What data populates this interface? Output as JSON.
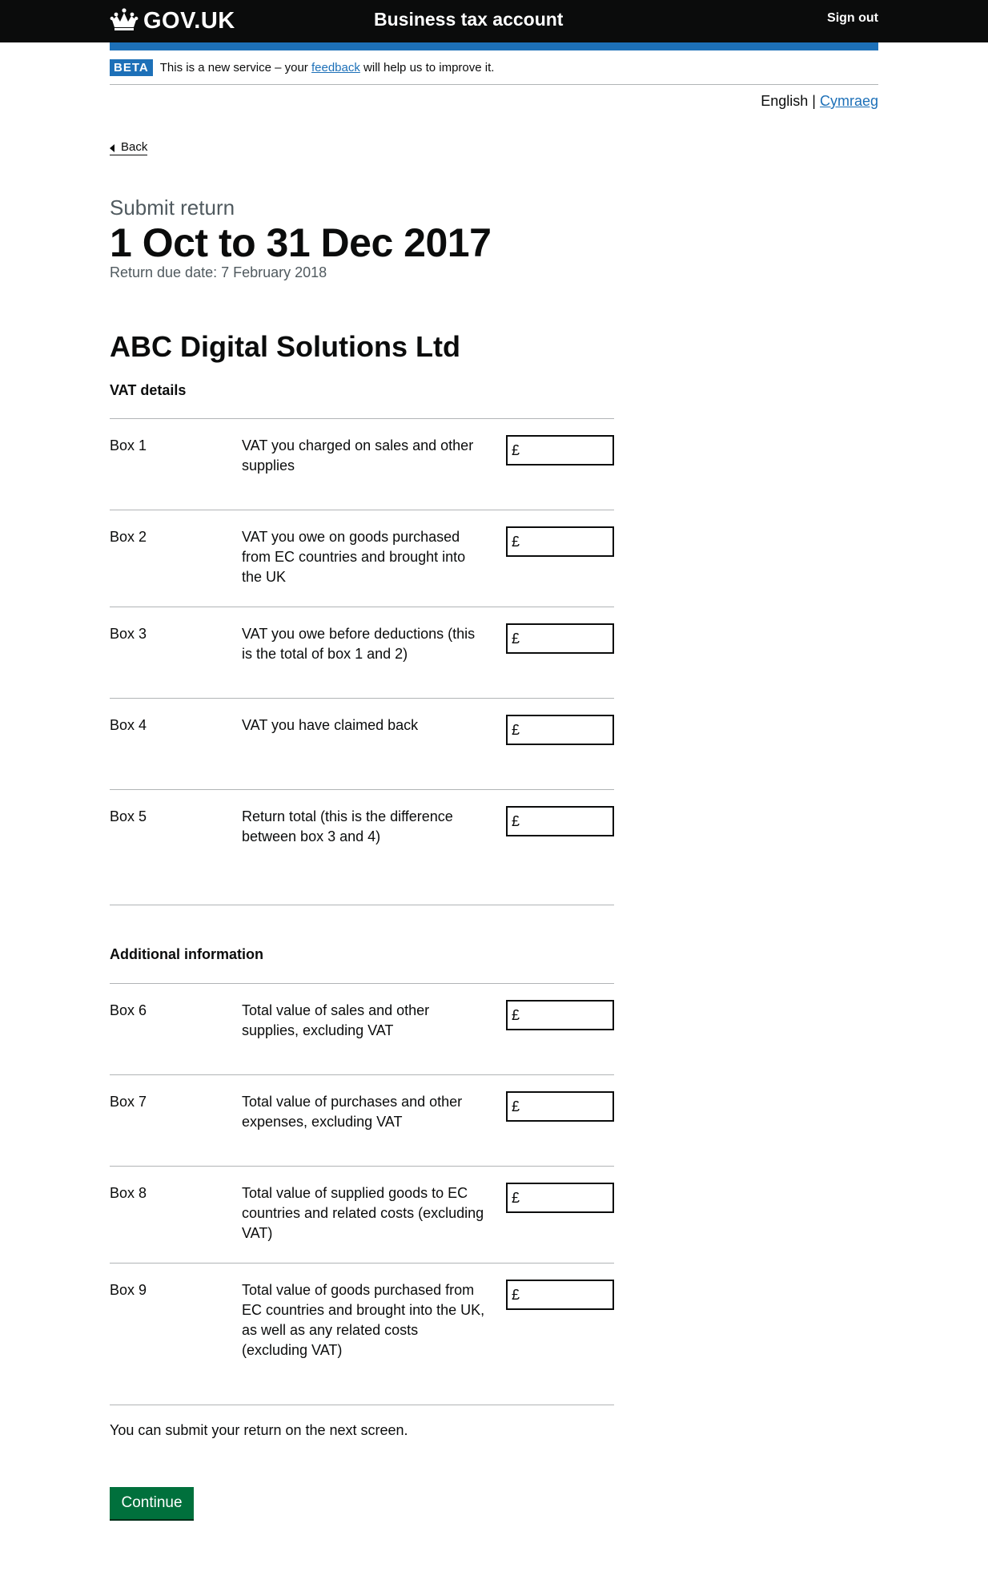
{
  "header": {
    "logo_text": "GOV.UK",
    "logo_icon": "crown-icon",
    "service_name": "Business tax account",
    "sign_out": "Sign out"
  },
  "phase_banner": {
    "tag": "BETA",
    "text_before": "This is a new service – your",
    "link": "feedback",
    "text_after": "will help us to improve it."
  },
  "language": {
    "current": "English",
    "separator": "|",
    "other": "Cymraeg"
  },
  "back_link": "Back",
  "page": {
    "caption": "Submit return",
    "title": "1 Oct to 31 Dec 2017",
    "due_date": "Return due date: 7 February 2018",
    "organisation": "ABC Digital Solutions Ltd"
  },
  "vat_details": {
    "title": "VAT details",
    "rows": [
      {
        "box": "Box 1",
        "description": "VAT you charged on sales and other supplies",
        "currency": "£"
      },
      {
        "box": "Box 2",
        "description": "VAT you owe on goods purchased from EC countries and brought into the UK",
        "currency": "£"
      },
      {
        "box": "Box 3",
        "description": "VAT you owe before deductions (this is the total of box 1 and 2)",
        "currency": "£"
      },
      {
        "box": "Box 4",
        "description": "VAT you have claimed back",
        "currency": "£"
      },
      {
        "box": "Box 5",
        "description": "Return total (this is the difference between box 3 and 4)",
        "currency": "£"
      }
    ]
  },
  "additional_info": {
    "title": "Additional information",
    "rows": [
      {
        "box": "Box 6",
        "description": "Total value of sales and other supplies, excluding VAT",
        "currency": "£"
      },
      {
        "box": "Box 7",
        "description": "Total value of purchases and other expenses, excluding VAT",
        "currency": "£"
      },
      {
        "box": "Box 8",
        "description": "Total value of supplied goods to EC countries and related costs (excluding VAT)",
        "currency": "£"
      },
      {
        "box": "Box 9",
        "description": "Total value of goods purchased from EC countries and brought into the UK, as well as any related costs (excluding VAT)",
        "currency": "£"
      }
    ]
  },
  "submit_note": "You can submit your return on the next screen.",
  "continue_button": "Continue",
  "colors": {
    "header_bg": "#0b0c0c",
    "brand_blue": "#1d70b8",
    "link": "#1d70b8",
    "button_green": "#00703c",
    "secondary_text": "#505a5f",
    "border": "#b1b4b6"
  }
}
